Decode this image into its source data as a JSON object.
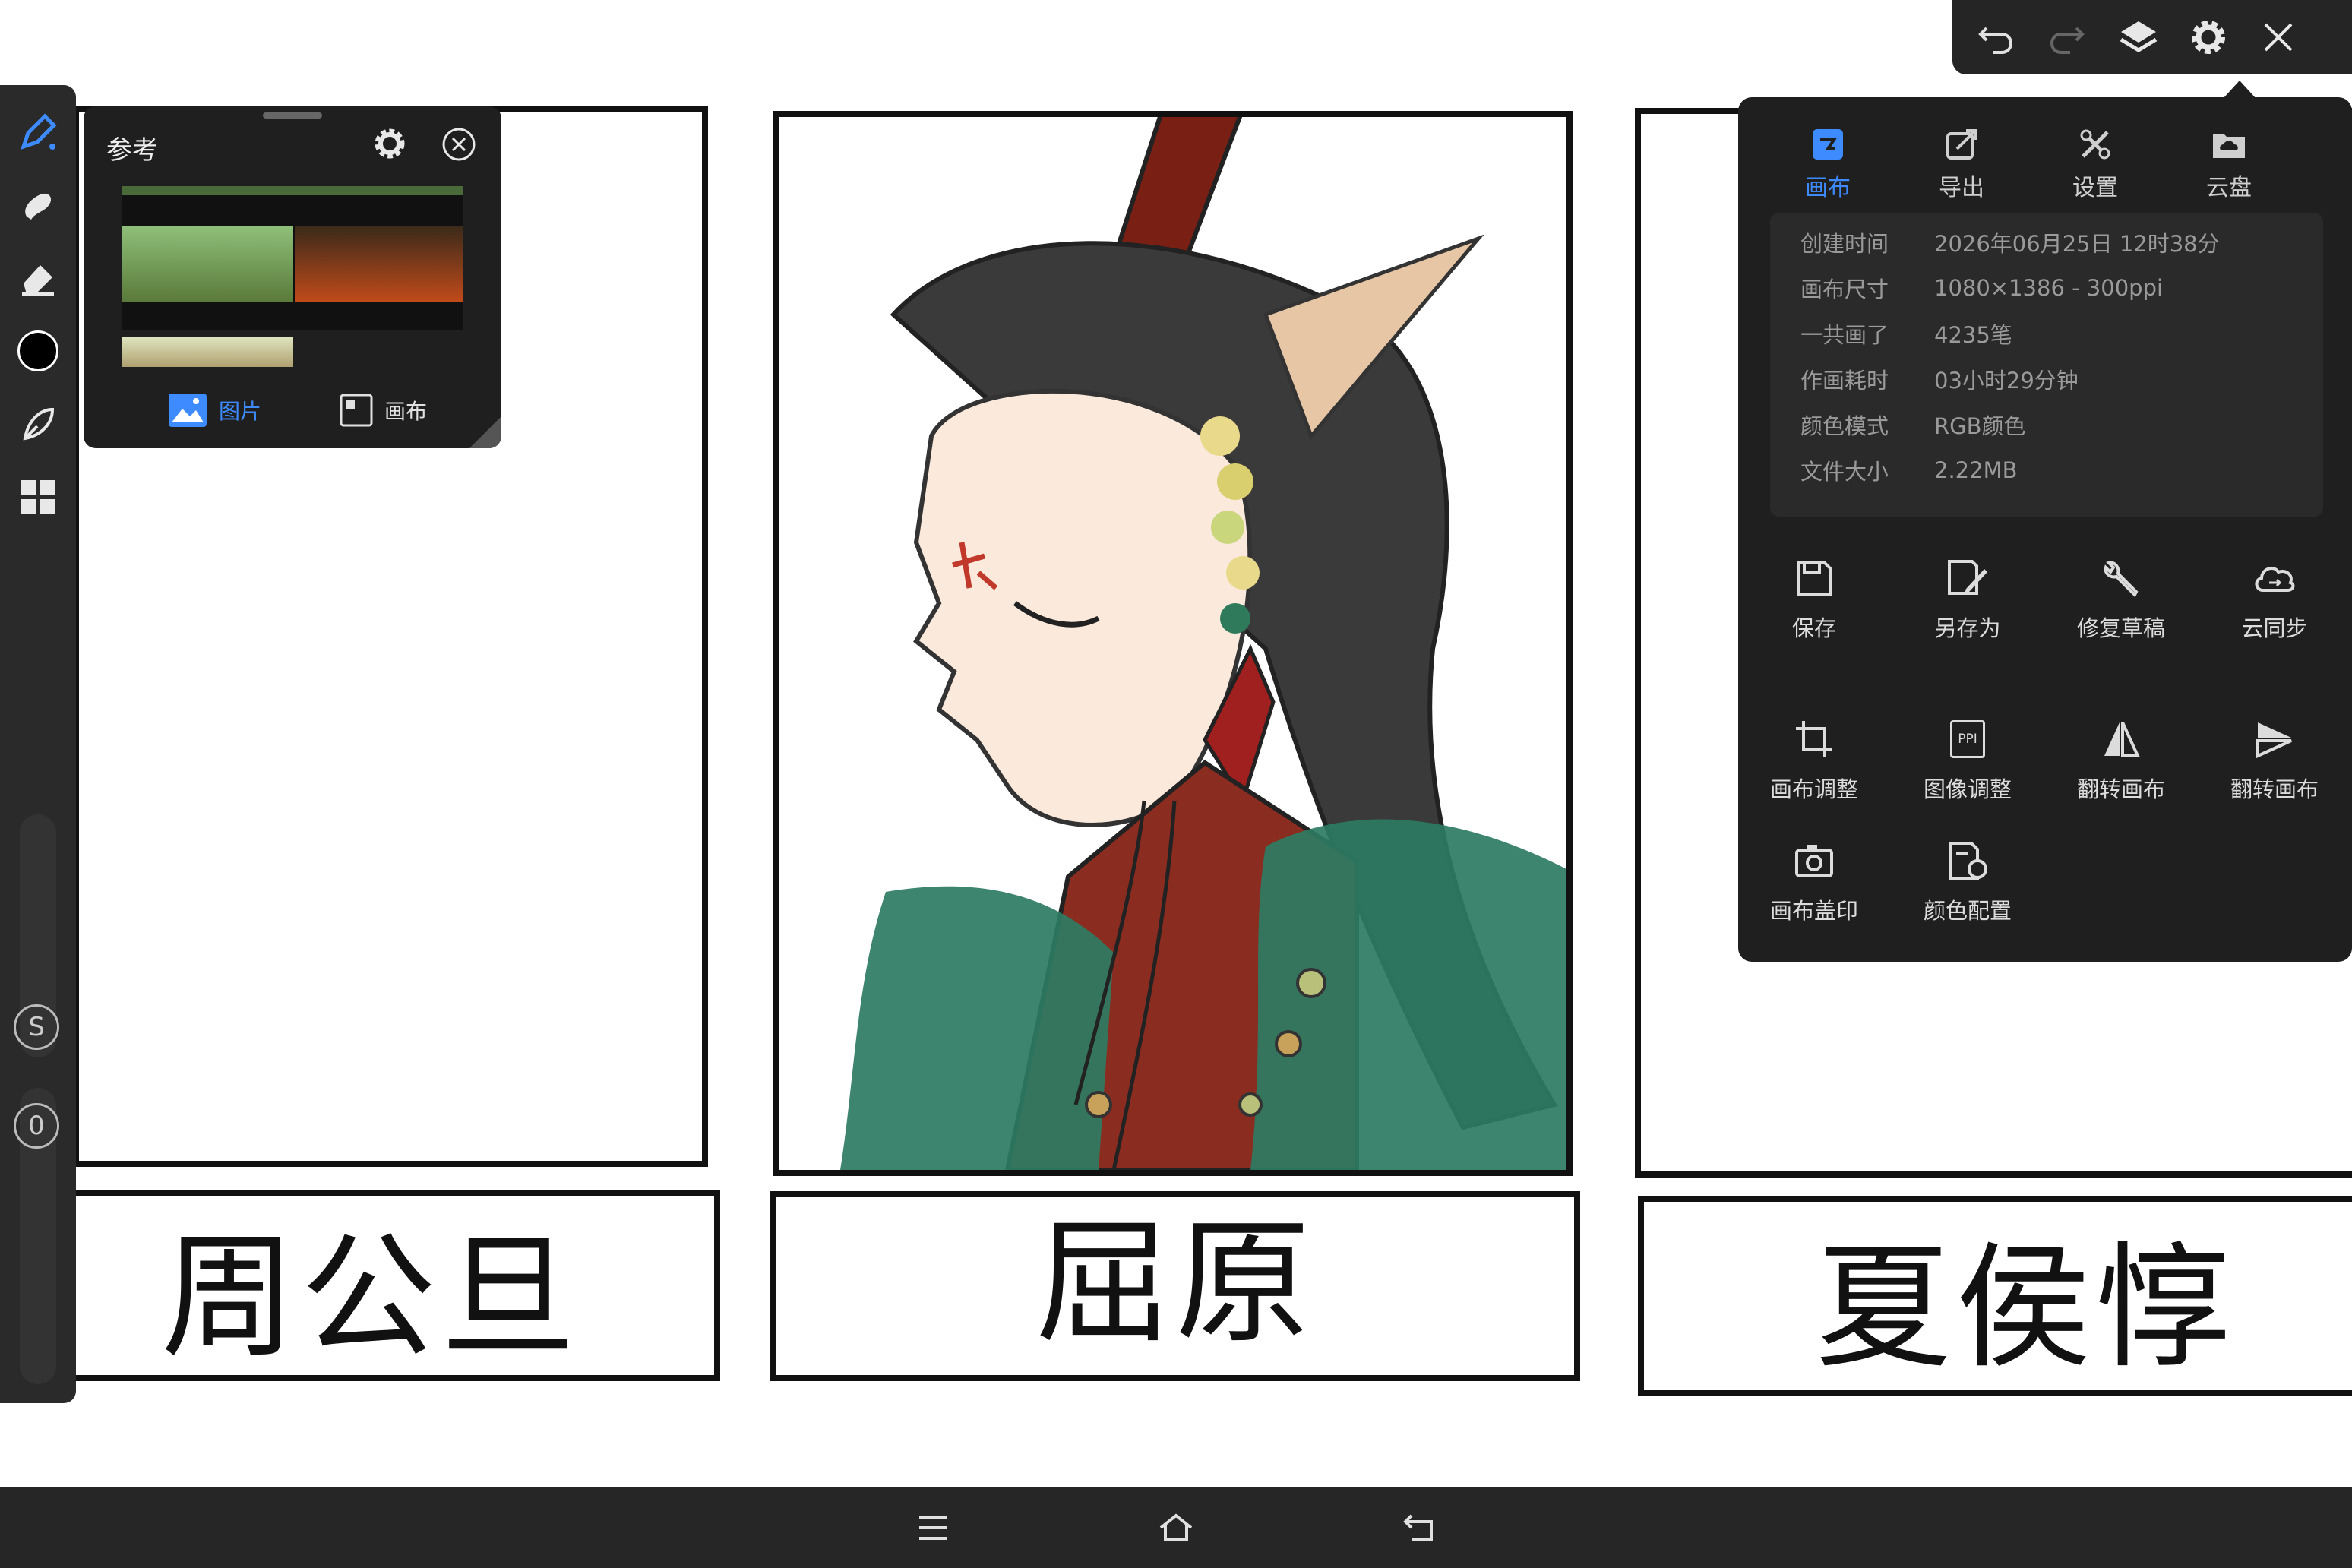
{
  "canvas": {
    "names": [
      "周公旦",
      "屈原",
      "夏侯惇"
    ]
  },
  "left_toolbar": {
    "tools": [
      {
        "name": "brush-icon"
      },
      {
        "name": "smudge-icon"
      },
      {
        "name": "eraser-icon"
      },
      {
        "name": "color-swatch",
        "color": "#000000"
      },
      {
        "name": "lasso-icon"
      },
      {
        "name": "grid-icon"
      }
    ],
    "size_label": "S",
    "opacity_label": "0"
  },
  "reference_panel": {
    "title": "参考",
    "tabs": [
      {
        "label": "图片",
        "active": true
      },
      {
        "label": "画布",
        "active": false
      }
    ]
  },
  "top_toolbar": {
    "icons": [
      "undo-icon",
      "redo-icon",
      "layers-icon",
      "gear-icon",
      "close-icon"
    ]
  },
  "canvas_menu": {
    "tabs": [
      {
        "label": "画布",
        "icon": "canvas-icon",
        "active": true
      },
      {
        "label": "导出",
        "icon": "export-icon",
        "active": false
      },
      {
        "label": "设置",
        "icon": "settings-tools-icon",
        "active": false
      },
      {
        "label": "云盘",
        "icon": "cloud-drive-icon",
        "active": false
      }
    ],
    "info": [
      {
        "key": "创建时间",
        "value": "2026年06月25日 12时38分"
      },
      {
        "key": "画布尺寸",
        "value": "1080×1386 - 300ppi"
      },
      {
        "key": "一共画了",
        "value": "4235笔"
      },
      {
        "key": "作画耗时",
        "value": "03小时29分钟"
      },
      {
        "key": "颜色模式",
        "value": "RGB颜色"
      },
      {
        "key": "文件大小",
        "value": "2.22MB"
      }
    ],
    "actions": [
      {
        "label": "保存"
      },
      {
        "label": "另存为"
      },
      {
        "label": "修复草稿"
      },
      {
        "label": "云同步"
      },
      {
        "label": "画布调整"
      },
      {
        "label": "图像调整",
        "badge": "PPI"
      },
      {
        "label": "翻转画布"
      },
      {
        "label": "翻转画布"
      },
      {
        "label": "画布盖印"
      },
      {
        "label": "颜色配置"
      }
    ],
    "accent": "#3d8bff"
  },
  "nav_bar": {
    "icons": [
      "menu-icon",
      "home-icon",
      "back-icon"
    ]
  }
}
